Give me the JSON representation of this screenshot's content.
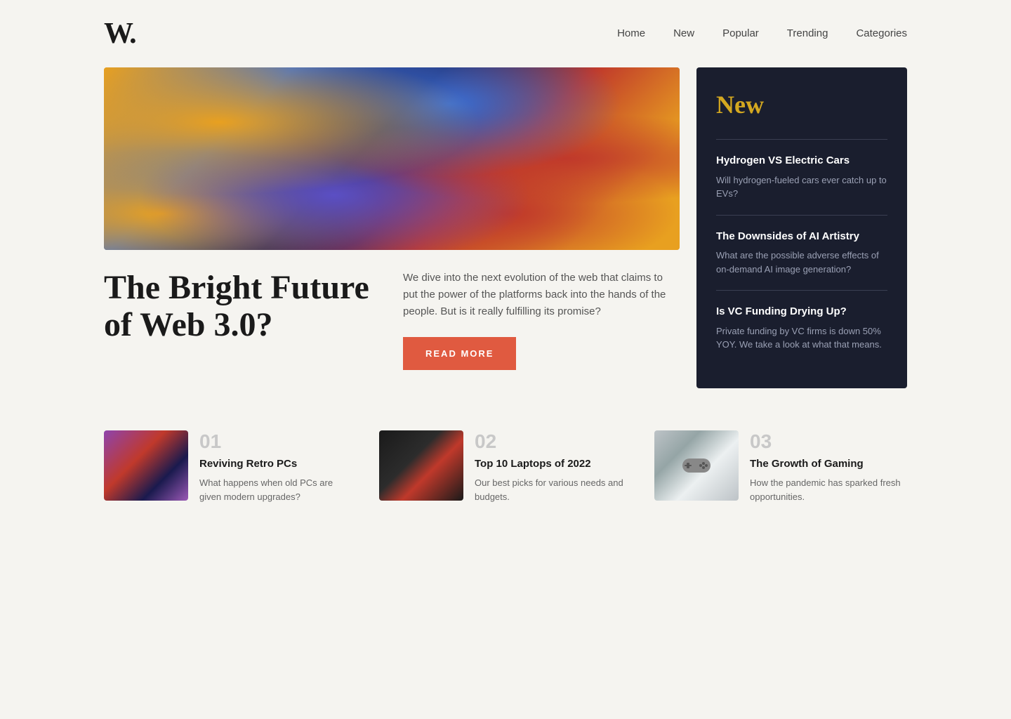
{
  "nav": {
    "logo": "W.",
    "links": [
      {
        "label": "Home",
        "id": "home"
      },
      {
        "label": "New",
        "id": "new"
      },
      {
        "label": "Popular",
        "id": "popular"
      },
      {
        "label": "Trending",
        "id": "trending"
      },
      {
        "label": "Categories",
        "id": "categories"
      }
    ]
  },
  "hero": {
    "title": "The Bright Future of Web 3.0?",
    "description": "We dive into the next evolution of the web that claims to put the power of the platforms back into the hands of the people. But is it really fulfilling its promise?",
    "read_more_label": "READ MORE"
  },
  "new_panel": {
    "title": "New",
    "items": [
      {
        "title": "Hydrogen VS Electric Cars",
        "description": "Will hydrogen-fueled cars ever catch up to EVs?"
      },
      {
        "title": "The Downsides of AI Artistry",
        "description": "What are the possible adverse effects of on-demand AI image generation?"
      },
      {
        "title": "Is VC Funding Drying Up?",
        "description": "Private funding by VC firms is down 50% YOY. We take a look at what that means."
      }
    ]
  },
  "articles": [
    {
      "number": "01",
      "title": "Reviving Retro PCs",
      "description": "What happens when old PCs are given modern upgrades?",
      "thumb_type": "retro"
    },
    {
      "number": "02",
      "title": "Top 10 Laptops of 2022",
      "description": "Our best picks for various needs and budgets.",
      "thumb_type": "laptops"
    },
    {
      "number": "03",
      "title": "The Growth of Gaming",
      "description": "How the pandemic has sparked fresh opportunities.",
      "thumb_type": "gaming"
    }
  ],
  "colors": {
    "accent_gold": "#d4a820",
    "accent_red": "#e05a40",
    "dark_bg": "#1a1e2e",
    "body_bg": "#f5f4f0"
  }
}
